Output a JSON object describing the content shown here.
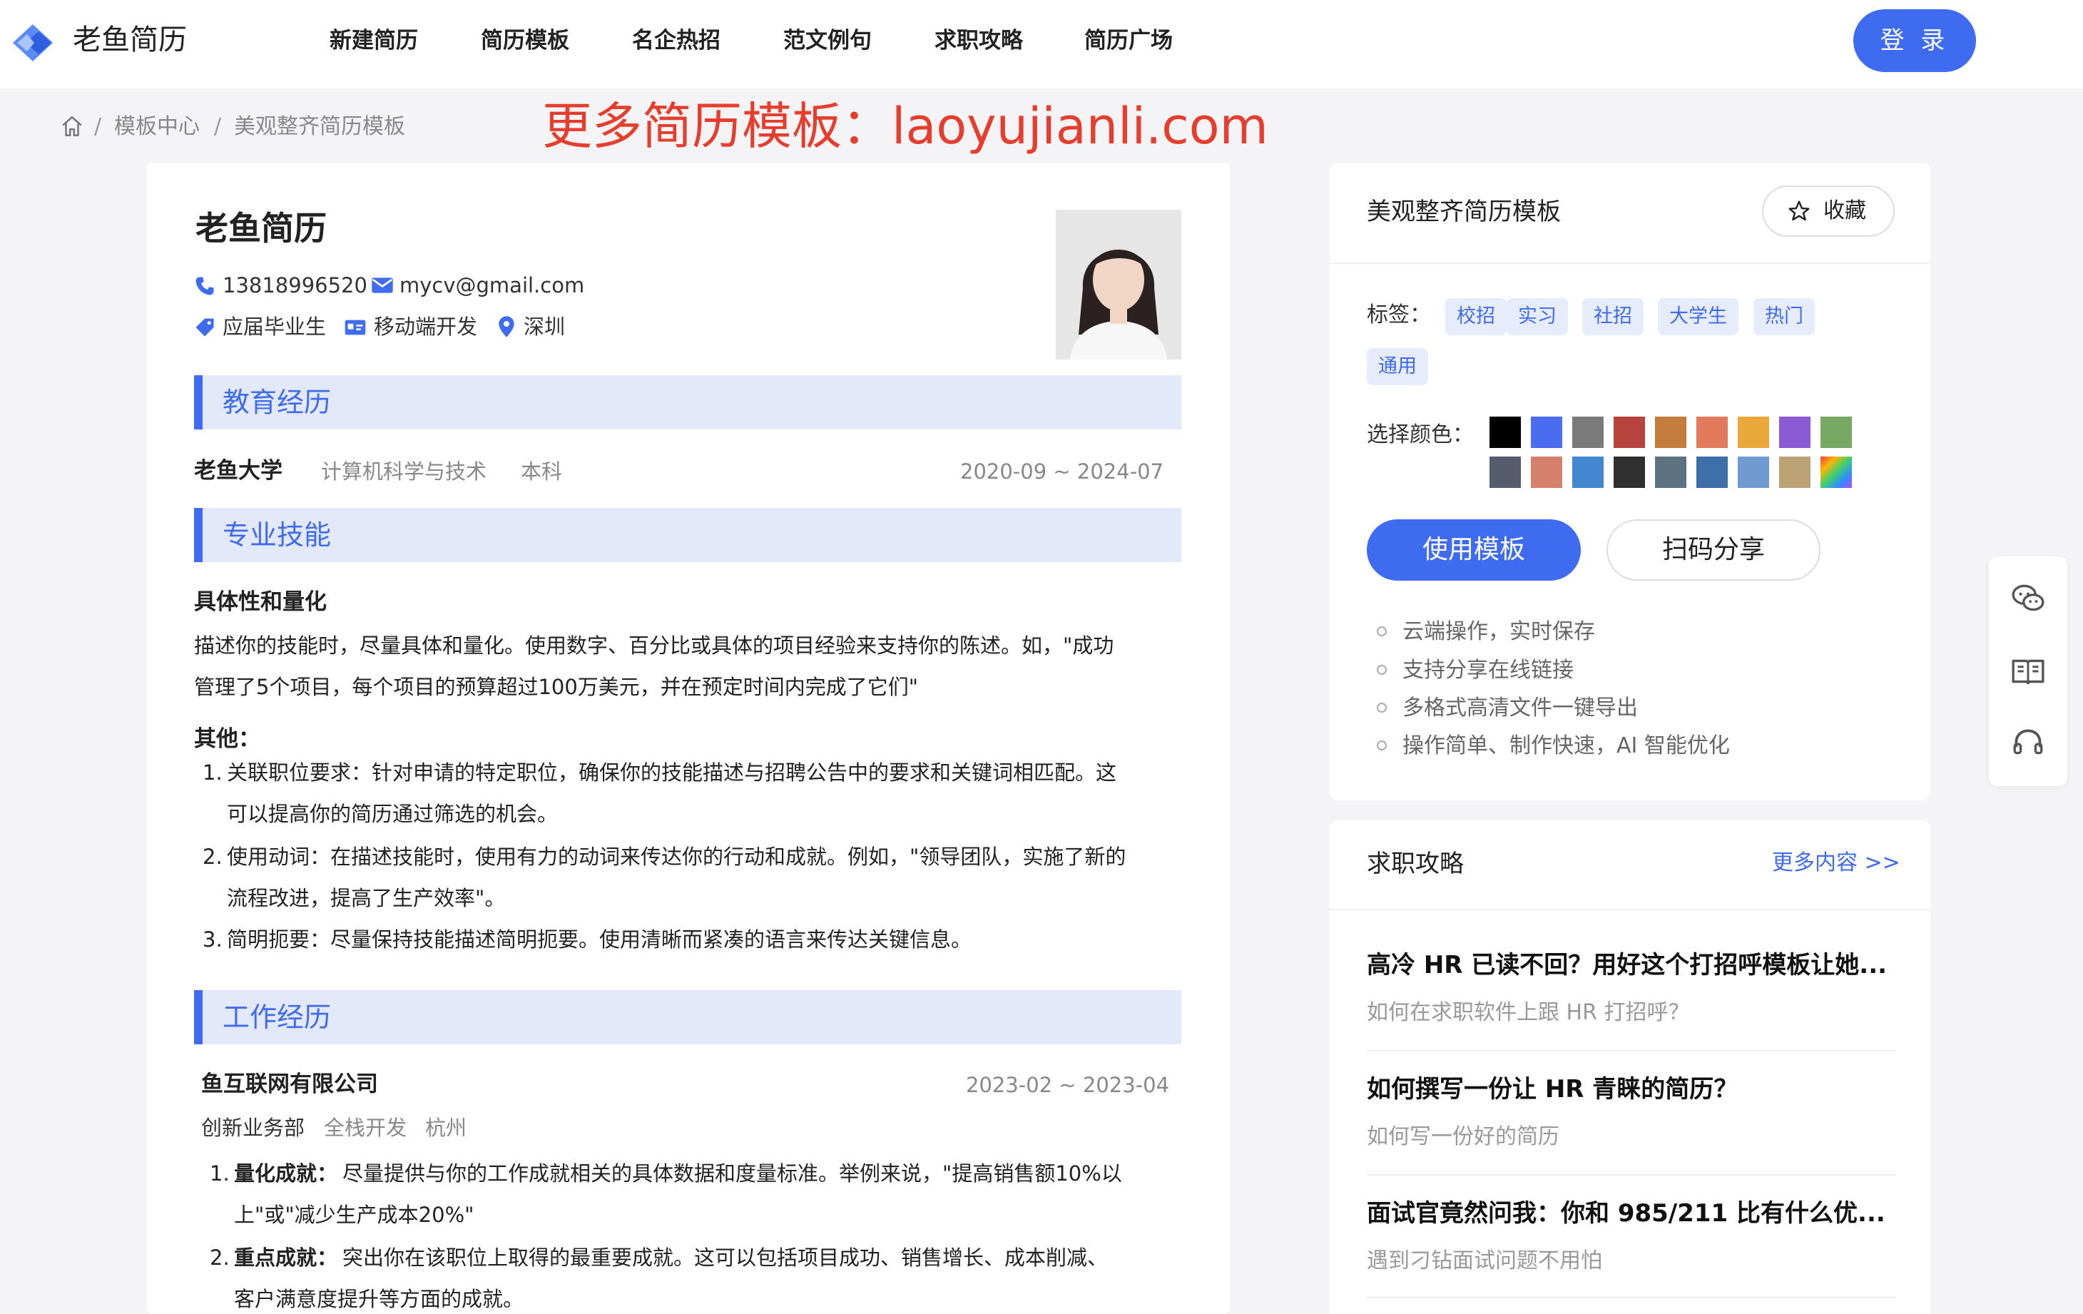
{
  "brand": {
    "name": "老鱼简历"
  },
  "nav": {
    "items": [
      "新建简历",
      "简历模板",
      "名企热招",
      "范文例句",
      "求职攻略",
      "简历广场"
    ],
    "login": "登 录"
  },
  "breadcrumb": {
    "items": [
      "模板中心",
      "美观整齐简历模板"
    ],
    "sep": "/"
  },
  "promo": "更多简历模板：laoyujianli.com",
  "resume": {
    "name": "老鱼简历",
    "phone": "13818996520",
    "email": "mycv@gmail.com",
    "status": "应届毕业生",
    "job": "移动端开发",
    "city": "深圳",
    "sections": {
      "education": "教育经历",
      "skills": "专业技能",
      "work": "工作经历"
    },
    "education": {
      "school": "老鱼大学",
      "major": "计算机科学与技术",
      "degree": "本科",
      "period": "2020-09 ~ 2024-07"
    },
    "skills": {
      "title": "具体性和量化",
      "desc_1": "描述你的技能时，尽量具体和量化。使用数字、百分比或具体的项目经验来支持你的陈述。如，\"成功",
      "desc_2": "管理了5个项目，每个项目的预算超过100万美元，并在预定时间内完成了它们\"",
      "other_title": "其他：",
      "items": [
        {
          "num": "1.",
          "l1": "关联职位要求：针对申请的特定职位，确保你的技能描述与招聘公告中的要求和关键词相匹配。这",
          "l2": "可以提高你的简历通过筛选的机会。"
        },
        {
          "num": "2.",
          "l1": "使用动词：在描述技能时，使用有力的动词来传达你的行动和成就。例如，\"领导团队，实施了新的",
          "l2": "流程改进，提高了生产效率\"。"
        },
        {
          "num": "3.",
          "l1": "简明扼要：尽量保持技能描述简明扼要。使用清晰而紧凑的语言来传达关键信息。",
          "l2": ""
        }
      ]
    },
    "work": {
      "company": "鱼互联网有限公司",
      "period": "2023-02 ~ 2023-04",
      "dept": "创新业务部",
      "role": "全栈开发",
      "city": "杭州",
      "items": [
        {
          "num": "1.",
          "head": "量化成就：",
          "l1": "尽量提供与你的工作成就相关的具体数据和度量标准。举例来说，\"提高销售额10%以",
          "l2": "上\"或\"减少生产成本20%\""
        },
        {
          "num": "2.",
          "head": "重点成就：",
          "l1": "突出你在该职位上取得的最重要成就。这可以包括项目成功、销售增长、成本削减、",
          "l2": "客户满意度提升等方面的成就。"
        }
      ]
    }
  },
  "panel": {
    "title": "美观整齐简历模板",
    "favorite": "收藏",
    "tags_label": "标签：",
    "tags": [
      "校招",
      "实习",
      "社招",
      "大学生",
      "热门",
      "通用"
    ],
    "color_label": "选择颜色：",
    "colors_row1": [
      "#000000",
      "#4a6cf0",
      "#7a7a7a",
      "#b7443c",
      "#c47c3c",
      "#e07a5a",
      "#eba83a",
      "#8b5bd6",
      "#77a864"
    ],
    "colors_row2": [
      "#565c6e",
      "#d4806a",
      "#4188d0",
      "#2f2f2f",
      "#5d7280",
      "#3f6fa8",
      "#6f9bd0",
      "#bba275",
      "rainbow"
    ],
    "use_btn": "使用模板",
    "share_btn": "扫码分享",
    "features": [
      "云端操作，实时保存",
      "支持分享在线链接",
      "多格式高清文件一键导出",
      "操作简单、制作快速，AI 智能优化"
    ]
  },
  "guide": {
    "title": "求职攻略",
    "more": "更多内容 >>",
    "articles": [
      {
        "title": "高冷 HR 已读不回？用好这个打招呼模板让她...",
        "sub": "如何在求职软件上跟 HR 打招呼？"
      },
      {
        "title": "如何撰写一份让 HR 青睐的简历？",
        "sub": "如何写一份好的简历"
      },
      {
        "title": "面试官竟然问我：你和 985/211 比有什么优...",
        "sub": "遇到刁钻面试问题不用怕"
      }
    ]
  },
  "accent": "#3e6bf0",
  "promo_color": "#e53e2f"
}
